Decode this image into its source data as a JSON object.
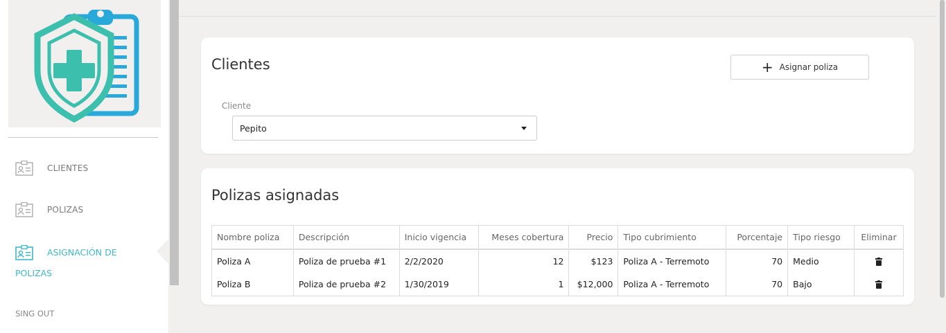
{
  "sidebar": {
    "items": [
      {
        "label": "CLIENTES"
      },
      {
        "label": "POLIZAS"
      },
      {
        "label_line1": "ASIGNACIÓN DE",
        "label_line2": "POLIZAS"
      }
    ],
    "signout": "SING OUT"
  },
  "clientes_card": {
    "title": "Clientes",
    "assign_button": "Asignar poliza",
    "field_label": "Cliente",
    "selected_client": "Pepito"
  },
  "polizas_card": {
    "title": "Polizas asignadas",
    "columns": [
      "Nombre poliza",
      "Descripción",
      "Inicio vigencia",
      "Meses cobertura",
      "Precio",
      "Tipo cubrimiento",
      "Porcentaje",
      "Tipo riesgo",
      "Eliminar"
    ],
    "rows": [
      {
        "nombre": "Poliza A",
        "descripcion": "Poliza de prueba #1",
        "inicio": "2/2/2020",
        "meses": "12",
        "precio": "$123",
        "tipo_cubrimiento": "Poliza A - Terremoto",
        "porcentaje": "70",
        "tipo_riesgo": "Medio"
      },
      {
        "nombre": "Poliza B",
        "descripcion": "Poliza de prueba #2",
        "inicio": "1/30/2019",
        "meses": "1",
        "precio": "$12,000",
        "tipo_cubrimiento": "Poliza A - Terremoto",
        "porcentaje": "70",
        "tipo_riesgo": "Bajo"
      }
    ]
  },
  "colors": {
    "accent": "#3fb8c8",
    "shield_teal": "#3dbfae",
    "clipboard_blue": "#29a9d9"
  },
  "icons": {
    "logo": "shield-clipboard-medical-icon",
    "nav": "id-card-icon",
    "add": "plus-icon",
    "delete": "trash-icon",
    "dropdown": "caret-down-icon"
  }
}
